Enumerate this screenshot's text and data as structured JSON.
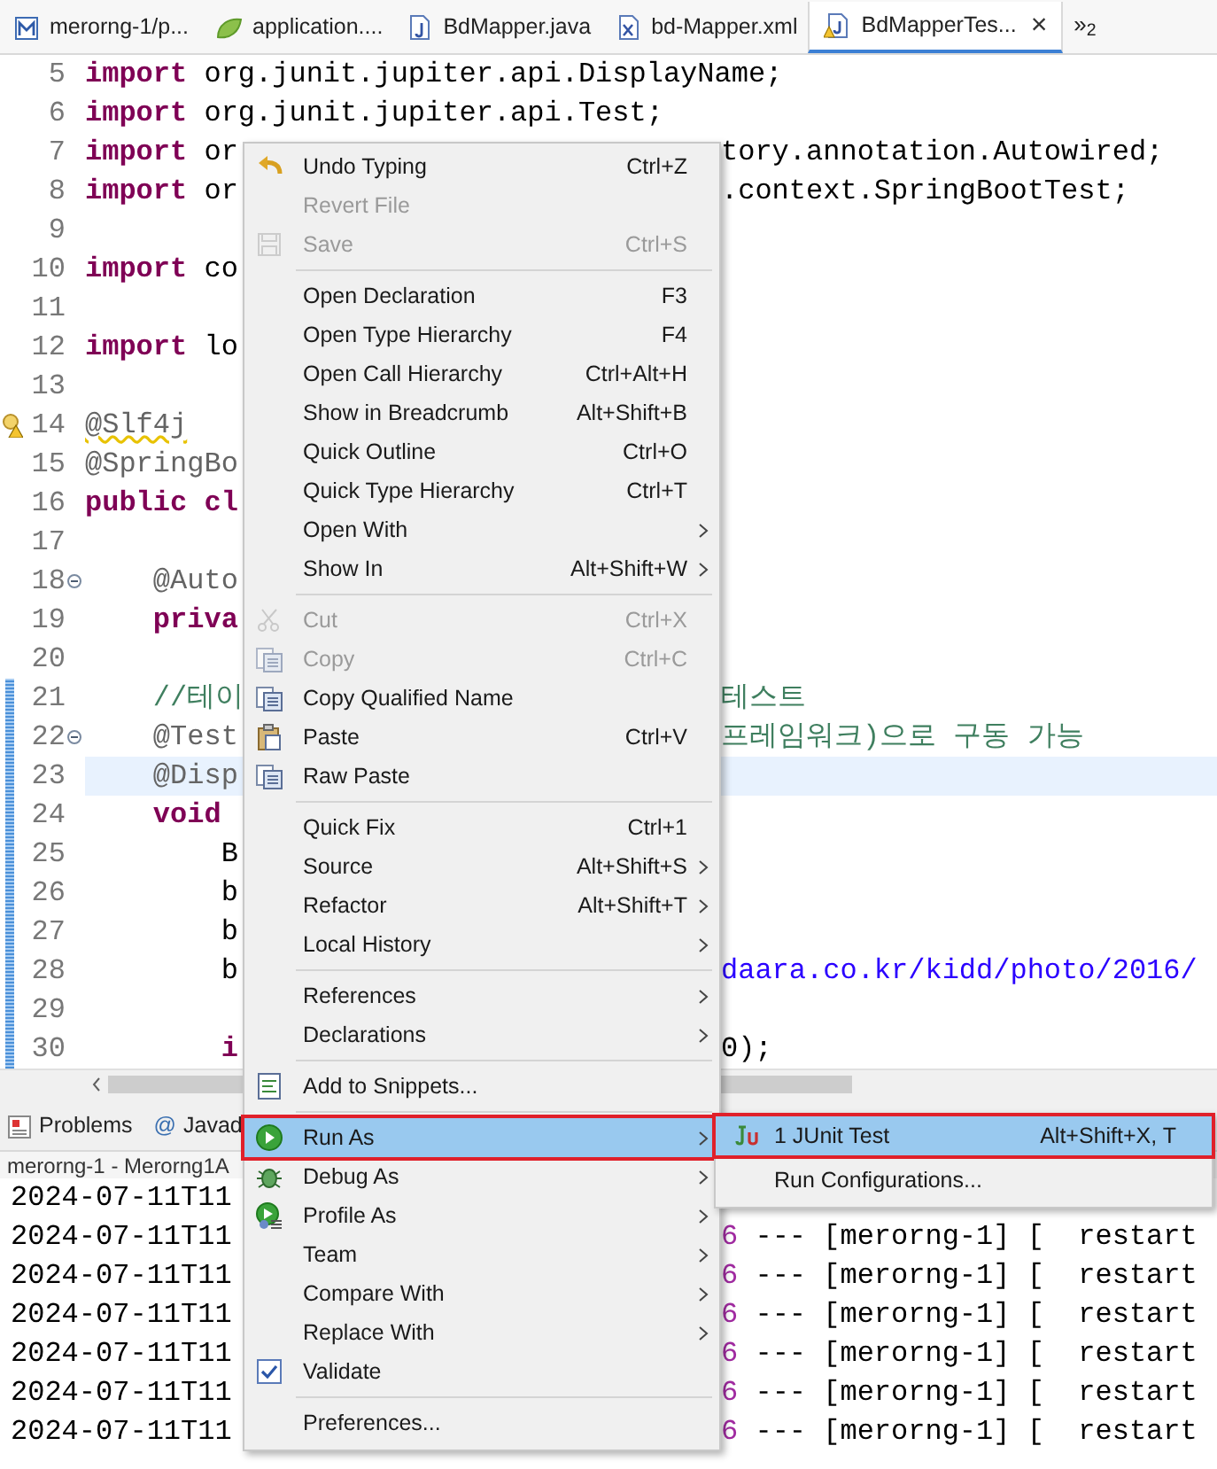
{
  "editor_tabs": [
    {
      "label": "merorng-1/p...",
      "kind": "maven",
      "selected": false
    },
    {
      "label": "application....",
      "kind": "spring",
      "selected": false
    },
    {
      "label": "BdMapper.java",
      "kind": "java",
      "selected": false
    },
    {
      "label": "bd-Mapper.xml",
      "kind": "xml",
      "selected": false
    },
    {
      "label": "BdMapperTes...",
      "kind": "java-warning",
      "selected": true,
      "close": "×"
    }
  ],
  "more_tabs": "»$_{2}$",
  "code_lines": [
    {
      "number": "5",
      "kind": "plain",
      "changed": false,
      "current": false,
      "left": [
        {
          "kind": "keyword",
          "text": "import"
        },
        {
          "kind": "plain",
          "text": " org.junit.jupiter.api.DisplayName;"
        }
      ]
    },
    {
      "number": "6",
      "kind": "plain",
      "changed": false,
      "current": false,
      "left": [
        {
          "kind": "keyword",
          "text": "import"
        },
        {
          "kind": "plain",
          "text": " org.junit.jupiter.api.Test;"
        }
      ]
    },
    {
      "number": "7",
      "kind": "plain",
      "changed": false,
      "current": false,
      "left": [
        {
          "kind": "keyword",
          "text": "import"
        },
        {
          "kind": "plain",
          "text": " or"
        }
      ],
      "right": [
        {
          "kind": "plain",
          "text": "tory.annotation.Autowired;"
        }
      ]
    },
    {
      "number": "8",
      "kind": "plain",
      "changed": false,
      "current": false,
      "left": [
        {
          "kind": "keyword",
          "text": "import"
        },
        {
          "kind": "plain",
          "text": " or"
        }
      ],
      "right": [
        {
          "kind": "plain",
          "text": ".context.SpringBootTest;"
        }
      ]
    },
    {
      "number": "9",
      "kind": "plain",
      "changed": false,
      "current": false
    },
    {
      "number": "10",
      "kind": "plain",
      "changed": false,
      "current": false,
      "left": [
        {
          "kind": "keyword",
          "text": "import"
        },
        {
          "kind": "plain",
          "text": " co"
        }
      ]
    },
    {
      "number": "11",
      "kind": "plain",
      "changed": false,
      "current": false
    },
    {
      "number": "12",
      "kind": "plain",
      "changed": false,
      "current": false,
      "left": [
        {
          "kind": "keyword",
          "text": "import"
        },
        {
          "kind": "plain",
          "text": " lo"
        }
      ]
    },
    {
      "number": "13",
      "kind": "plain",
      "changed": false,
      "current": false
    },
    {
      "number": "14",
      "kind": "warning",
      "changed": false,
      "current": false,
      "left": [
        {
          "kind": "warning",
          "text": "@Slf4j"
        }
      ]
    },
    {
      "number": "15",
      "kind": "plain",
      "changed": false,
      "current": false,
      "left": [
        {
          "kind": "annotation",
          "text": "@SpringBo"
        }
      ]
    },
    {
      "number": "16",
      "kind": "plain",
      "changed": false,
      "current": false,
      "left": [
        {
          "kind": "keyword",
          "text": "public cl"
        }
      ]
    },
    {
      "number": "17",
      "kind": "plain",
      "changed": false,
      "current": false
    },
    {
      "number": "18",
      "kind": "fold",
      "changed": false,
      "current": false,
      "left": [
        {
          "kind": "annotation",
          "text": "    @Auto"
        }
      ]
    },
    {
      "number": "19",
      "kind": "plain",
      "changed": false,
      "current": false,
      "left": [
        {
          "kind": "keyword",
          "text": "    priva"
        }
      ]
    },
    {
      "number": "20",
      "kind": "plain",
      "changed": false,
      "current": false
    },
    {
      "number": "21",
      "kind": "plain",
      "changed": true,
      "current": false,
      "left": [
        {
          "kind": "comment",
          "text": "    //테이"
        }
      ],
      "right": [
        {
          "kind": "comment",
          "text": "테스트"
        }
      ]
    },
    {
      "number": "22",
      "kind": "fold",
      "changed": true,
      "current": false,
      "left": [
        {
          "kind": "annotation",
          "text": "    @Test"
        }
      ],
      "right": [
        {
          "kind": "comment",
          "text": "프레임워크)으로 구동 가능"
        }
      ]
    },
    {
      "number": "23",
      "kind": "plain",
      "changed": true,
      "current": true,
      "left": [
        {
          "kind": "annotation",
          "text": "    @Disp"
        }
      ]
    },
    {
      "number": "24",
      "kind": "plain",
      "changed": true,
      "current": false,
      "left": [
        {
          "kind": "keyword",
          "text": "    void"
        }
      ]
    },
    {
      "number": "25",
      "kind": "plain",
      "changed": true,
      "current": false,
      "left": [
        {
          "kind": "plain",
          "text": "        B"
        }
      ]
    },
    {
      "number": "26",
      "kind": "plain",
      "changed": true,
      "current": false,
      "left": [
        {
          "kind": "plain",
          "text": "        b"
        }
      ]
    },
    {
      "number": "27",
      "kind": "plain",
      "changed": true,
      "current": false,
      "left": [
        {
          "kind": "plain",
          "text": "        b"
        }
      ]
    },
    {
      "number": "28",
      "kind": "plain",
      "changed": true,
      "current": false,
      "left": [
        {
          "kind": "plain",
          "text": "        b"
        }
      ],
      "right": [
        {
          "kind": "link",
          "text": "daara.co.kr/kidd/photo/2016/"
        }
      ]
    },
    {
      "number": "29",
      "kind": "plain",
      "changed": true,
      "current": false
    },
    {
      "number": "30",
      "kind": "plain",
      "changed": true,
      "current": false,
      "left": [
        {
          "kind": "keyword",
          "text": "        i"
        }
      ],
      "right": [
        {
          "kind": "plain",
          "text": "0);"
        }
      ]
    }
  ],
  "panel_tabs": [
    {
      "label": "Problems",
      "kind": "problems",
      "selected": false
    },
    {
      "label": "Javad",
      "kind": "plain",
      "icon_char": "@",
      "selected": false
    }
  ],
  "console_title": "merorng-1 - Merorng1A",
  "console_lines": [
    {
      "left": [
        {
          "kind": "plain",
          "text": "2024-07-11T11"
        }
      ]
    },
    {
      "left": [
        {
          "kind": "plain",
          "text": "2024-07-11T11"
        }
      ],
      "right": [
        {
          "kind": "pid",
          "text": "6"
        },
        {
          "kind": "plain",
          "text": " --- [merorng-1] [  restart"
        }
      ]
    },
    {
      "left": [
        {
          "kind": "plain",
          "text": "2024-07-11T11"
        }
      ],
      "right": [
        {
          "kind": "pid",
          "text": "6"
        },
        {
          "kind": "plain",
          "text": " --- [merorng-1] [  restart"
        }
      ]
    },
    {
      "left": [
        {
          "kind": "plain",
          "text": "2024-07-11T11"
        }
      ],
      "right": [
        {
          "kind": "pid",
          "text": "6"
        },
        {
          "kind": "plain",
          "text": " --- [merorng-1] [  restart"
        }
      ]
    },
    {
      "left": [
        {
          "kind": "plain",
          "text": "2024-07-11T11"
        }
      ],
      "right": [
        {
          "kind": "pid",
          "text": "6"
        },
        {
          "kind": "plain",
          "text": " --- [merorng-1] [  restart"
        }
      ]
    },
    {
      "left": [
        {
          "kind": "plain",
          "text": "2024-07-11T11"
        }
      ],
      "right": [
        {
          "kind": "pid",
          "text": "6"
        },
        {
          "kind": "plain",
          "text": " --- [merorng-1] [  restart"
        }
      ]
    },
    {
      "left": [
        {
          "kind": "plain",
          "text": "2024-07-11T11"
        }
      ],
      "right": [
        {
          "kind": "pid",
          "text": "6"
        },
        {
          "kind": "plain",
          "text": " --- [merorng-1] [  restart"
        }
      ]
    }
  ],
  "context_menu": [
    {
      "kind": "undo",
      "label": "Undo Typing",
      "shortcut": "Ctrl+Z",
      "disabled": false,
      "submenu": false,
      "selected": false,
      "boxed": false
    },
    {
      "kind": "plain",
      "label": "Revert File",
      "disabled": true,
      "submenu": false,
      "selected": false,
      "boxed": false
    },
    {
      "kind": "save",
      "label": "Save",
      "shortcut": "Ctrl+S",
      "disabled": true,
      "submenu": false,
      "selected": false,
      "boxed": false
    },
    {
      "kind": "separator"
    },
    {
      "kind": "plain",
      "label": "Open Declaration",
      "shortcut": "F3",
      "disabled": false,
      "submenu": false,
      "selected": false,
      "boxed": false
    },
    {
      "kind": "plain",
      "label": "Open Type Hierarchy",
      "shortcut": "F4",
      "disabled": false,
      "submenu": false,
      "selected": false,
      "boxed": false
    },
    {
      "kind": "plain",
      "label": "Open Call Hierarchy",
      "shortcut": "Ctrl+Alt+H",
      "disabled": false,
      "submenu": false,
      "selected": false,
      "boxed": false
    },
    {
      "kind": "plain",
      "label": "Show in Breadcrumb",
      "shortcut": "Alt+Shift+B",
      "disabled": false,
      "submenu": false,
      "selected": false,
      "boxed": false
    },
    {
      "kind": "plain",
      "label": "Quick Outline",
      "shortcut": "Ctrl+O",
      "disabled": false,
      "submenu": false,
      "selected": false,
      "boxed": false
    },
    {
      "kind": "plain",
      "label": "Quick Type Hierarchy",
      "shortcut": "Ctrl+T",
      "disabled": false,
      "submenu": false,
      "selected": false,
      "boxed": false
    },
    {
      "kind": "plain",
      "label": "Open With",
      "disabled": false,
      "submenu": true,
      "selected": false,
      "boxed": false
    },
    {
      "kind": "plain",
      "label": "Show In",
      "shortcut": "Alt+Shift+W",
      "disabled": false,
      "submenu": true,
      "selected": false,
      "boxed": false
    },
    {
      "kind": "separator"
    },
    {
      "kind": "cut",
      "label": "Cut",
      "shortcut": "Ctrl+X",
      "disabled": true,
      "submenu": false,
      "selected": false,
      "boxed": false
    },
    {
      "kind": "copy",
      "label": "Copy",
      "shortcut": "Ctrl+C",
      "disabled": true,
      "submenu": false,
      "selected": false,
      "boxed": false
    },
    {
      "kind": "copy",
      "label": "Copy Qualified Name",
      "disabled": false,
      "submenu": false,
      "selected": false,
      "boxed": false
    },
    {
      "kind": "paste",
      "label": "Paste",
      "shortcut": "Ctrl+V",
      "disabled": false,
      "submenu": false,
      "selected": false,
      "boxed": false
    },
    {
      "kind": "copy",
      "label": "Raw Paste",
      "disabled": false,
      "submenu": false,
      "selected": false,
      "boxed": false
    },
    {
      "kind": "separator"
    },
    {
      "kind": "plain",
      "label": "Quick Fix",
      "shortcut": "Ctrl+1",
      "disabled": false,
      "submenu": false,
      "selected": false,
      "boxed": false
    },
    {
      "kind": "plain",
      "label": "Source",
      "shortcut": "Alt+Shift+S",
      "disabled": false,
      "submenu": true,
      "selected": false,
      "boxed": false
    },
    {
      "kind": "plain",
      "label": "Refactor",
      "shortcut": "Alt+Shift+T",
      "disabled": false,
      "submenu": true,
      "selected": false,
      "boxed": false
    },
    {
      "kind": "plain",
      "label": "Local History",
      "disabled": false,
      "submenu": true,
      "selected": false,
      "boxed": false
    },
    {
      "kind": "separator"
    },
    {
      "kind": "plain",
      "label": "References",
      "disabled": false,
      "submenu": true,
      "selected": false,
      "boxed": false
    },
    {
      "kind": "plain",
      "label": "Declarations",
      "disabled": false,
      "submenu": true,
      "selected": false,
      "boxed": false
    },
    {
      "kind": "separator"
    },
    {
      "kind": "snippet",
      "label": "Add to Snippets...",
      "disabled": false,
      "submenu": false,
      "selected": false,
      "boxed": false
    },
    {
      "kind": "separator"
    },
    {
      "kind": "run",
      "label": "Run As",
      "disabled": false,
      "submenu": true,
      "selected": true,
      "boxed": true
    },
    {
      "kind": "bug",
      "label": "Debug As",
      "disabled": false,
      "submenu": true,
      "selected": false,
      "boxed": false
    },
    {
      "kind": "profile",
      "label": "Profile As",
      "disabled": false,
      "submenu": true,
      "selected": false,
      "boxed": false
    },
    {
      "kind": "plain",
      "label": "Team",
      "disabled": false,
      "submenu": true,
      "selected": false,
      "boxed": false
    },
    {
      "kind": "plain",
      "label": "Compare With",
      "disabled": false,
      "submenu": true,
      "selected": false,
      "boxed": false
    },
    {
      "kind": "plain",
      "label": "Replace With",
      "disabled": false,
      "submenu": true,
      "selected": false,
      "boxed": false
    },
    {
      "kind": "check",
      "label": "Validate",
      "disabled": false,
      "submenu": false,
      "selected": false,
      "boxed": false
    },
    {
      "kind": "separator"
    },
    {
      "kind": "plain",
      "label": "Preferences...",
      "disabled": false,
      "submenu": false,
      "selected": false,
      "boxed": false
    }
  ],
  "run_as_submenu": [
    {
      "kind": "junit",
      "label": "1 JUnit Test",
      "shortcut": "Alt+Shift+X, T",
      "selected": true,
      "boxed": true
    },
    {
      "kind": "plain",
      "label": "Run Configurations...",
      "selected": false,
      "boxed": false
    }
  ]
}
